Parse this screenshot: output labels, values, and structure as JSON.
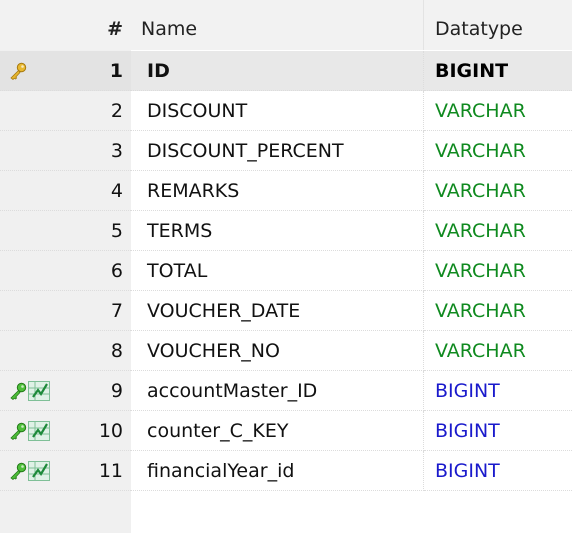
{
  "header": {
    "num_label": "#",
    "name_label": "Name",
    "type_label": "Datatype"
  },
  "colors": {
    "varchar": "#0f8a1f",
    "bigint_fk": "#1a1acc",
    "bigint_pk": "#000000"
  },
  "rows": [
    {
      "num": "1",
      "name": "ID",
      "type": "BIGINT",
      "key": "primary",
      "selected": true
    },
    {
      "num": "2",
      "name": "DISCOUNT",
      "type": "VARCHAR",
      "key": "none"
    },
    {
      "num": "3",
      "name": "DISCOUNT_PERCENT",
      "type": "VARCHAR",
      "key": "none"
    },
    {
      "num": "4",
      "name": "REMARKS",
      "type": "VARCHAR",
      "key": "none"
    },
    {
      "num": "5",
      "name": "TERMS",
      "type": "VARCHAR",
      "key": "none"
    },
    {
      "num": "6",
      "name": "TOTAL",
      "type": "VARCHAR",
      "key": "none"
    },
    {
      "num": "7",
      "name": "VOUCHER_DATE",
      "type": "VARCHAR",
      "key": "none"
    },
    {
      "num": "8",
      "name": "VOUCHER_NO",
      "type": "VARCHAR",
      "key": "none"
    },
    {
      "num": "9",
      "name": "accountMaster_ID",
      "type": "BIGINT",
      "key": "foreign"
    },
    {
      "num": "10",
      "name": "counter_C_KEY",
      "type": "BIGINT",
      "key": "foreign"
    },
    {
      "num": "11",
      "name": "financialYear_id",
      "type": "BIGINT",
      "key": "foreign"
    }
  ]
}
